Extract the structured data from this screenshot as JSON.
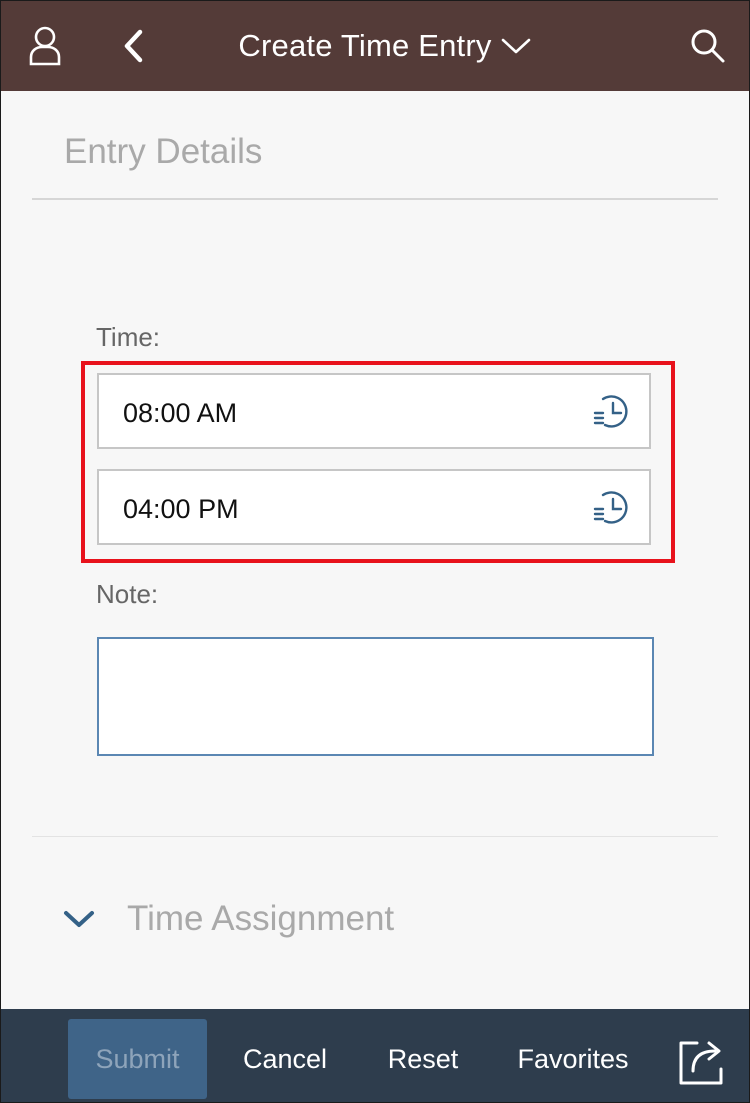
{
  "header": {
    "title": "Create Time Entry",
    "icons": {
      "user": "user-icon",
      "back": "back-icon",
      "title_dropdown": "chevron-down-icon",
      "search": "search-icon"
    },
    "background_color": "#543b38"
  },
  "section": {
    "title": "Entry Details"
  },
  "time": {
    "label": "Time:",
    "start": "08:00 AM",
    "end": "04:00 PM",
    "icon": "time-picker-icon"
  },
  "note": {
    "label": "Note:",
    "value": ""
  },
  "time_assignment": {
    "label": "Time Assignment",
    "icon": "chevron-down-icon"
  },
  "footer": {
    "submit": "Submit",
    "cancel": "Cancel",
    "reset": "Reset",
    "favorites": "Favorites",
    "share_icon": "share-icon",
    "background_color": "#2e3d4d"
  },
  "highlight_color": "#e8121c"
}
